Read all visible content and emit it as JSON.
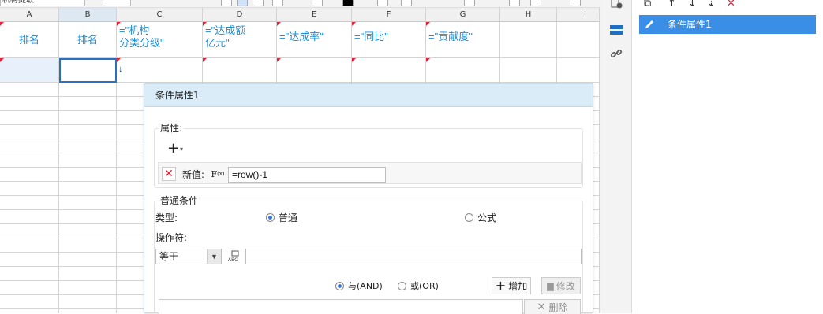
{
  "toolbar": {
    "cell_ref": "机构提取"
  },
  "columns": [
    "A",
    "B",
    "C",
    "D",
    "E",
    "F",
    "G",
    "H",
    "I"
  ],
  "selected_column": "B",
  "header_cells": [
    {
      "col": "A",
      "text": "排名"
    },
    {
      "col": "B",
      "text": "排名"
    },
    {
      "col": "C",
      "text": "=\"机构\n分类分级\""
    },
    {
      "col": "D",
      "text": "=\"达成额\n亿元\""
    },
    {
      "col": "E",
      "text": "=\"达成率\""
    },
    {
      "col": "F",
      "text": "=\"同比\""
    },
    {
      "col": "G",
      "text": "=\"贡献度\""
    }
  ],
  "right_panel": {
    "toolbar_icons": [
      "copy-icon",
      "arrow-up-icon",
      "arrow-down-icon",
      "move-bottom-icon",
      "delete-icon"
    ],
    "items": [
      {
        "label": "条件属性1",
        "selected": true
      }
    ]
  },
  "side_icons": [
    "cell-attr-icon",
    "condition-attr-icon",
    "link-icon"
  ],
  "dialog": {
    "title": "条件属性1",
    "attr_section": {
      "label": "属性:",
      "row": {
        "name_label": "新值:",
        "formula_value": "=row()-1"
      }
    },
    "condition_section": {
      "label": "普通条件",
      "type_label": "类型:",
      "type_options": [
        {
          "label": "普通",
          "checked": true
        },
        {
          "label": "公式",
          "checked": false
        }
      ],
      "operator_label": "操作符:",
      "operator_value": "等于",
      "logic_options": [
        {
          "label": "与(AND)",
          "checked": true
        },
        {
          "label": "或(OR)",
          "checked": false
        }
      ],
      "add_label": "增加",
      "modify_label": "修改",
      "delete_label": "删除"
    }
  }
}
